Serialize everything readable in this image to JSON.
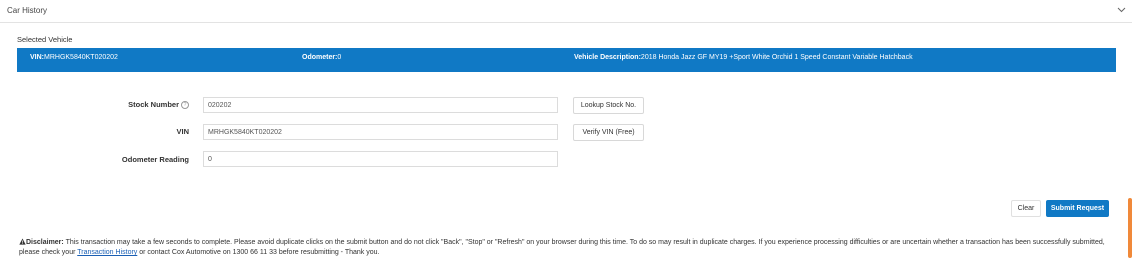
{
  "header": {
    "title": "Car History"
  },
  "selected_vehicle": {
    "label": "Selected Vehicle",
    "vin_label": "VIN:",
    "vin_value": "MRHGK5840KT020202",
    "odometer_label": "Odometer:",
    "odometer_value": "0",
    "description_label": "Vehicle Description:",
    "description_value": "2018 Honda Jazz GF MY19 +Sport White Orchid 1 Speed Constant Variable Hatchback"
  },
  "form": {
    "stock_number": {
      "label": "Stock Number",
      "value": "020202",
      "button": "Lookup Stock No."
    },
    "vin": {
      "label": "VIN",
      "value": "MRHGK5840KT020202",
      "button": "Verify VIN (Free)"
    },
    "odometer": {
      "label": "Odometer Reading",
      "value": "0"
    }
  },
  "actions": {
    "clear": "Clear",
    "submit": "Submit Request"
  },
  "disclaimer": {
    "label": "Disclaimer:",
    "text_before": " This transaction may take a few seconds to complete. Please avoid duplicate clicks on the submit button and do not click \"Back\", \"Stop\" or \"Refresh\" on your browser during this time. To do so may result in duplicate charges. If you experience processing difficulties or are uncertain whether a transaction has been successfully submitted, please check your ",
    "link": "Transaction History",
    "text_after": " or contact Cox Automotive on 1300 66 11 33 before resubmitting - Thank you."
  },
  "colors": {
    "accent": "#1079c5",
    "scroll_accent": "#f0893a"
  }
}
